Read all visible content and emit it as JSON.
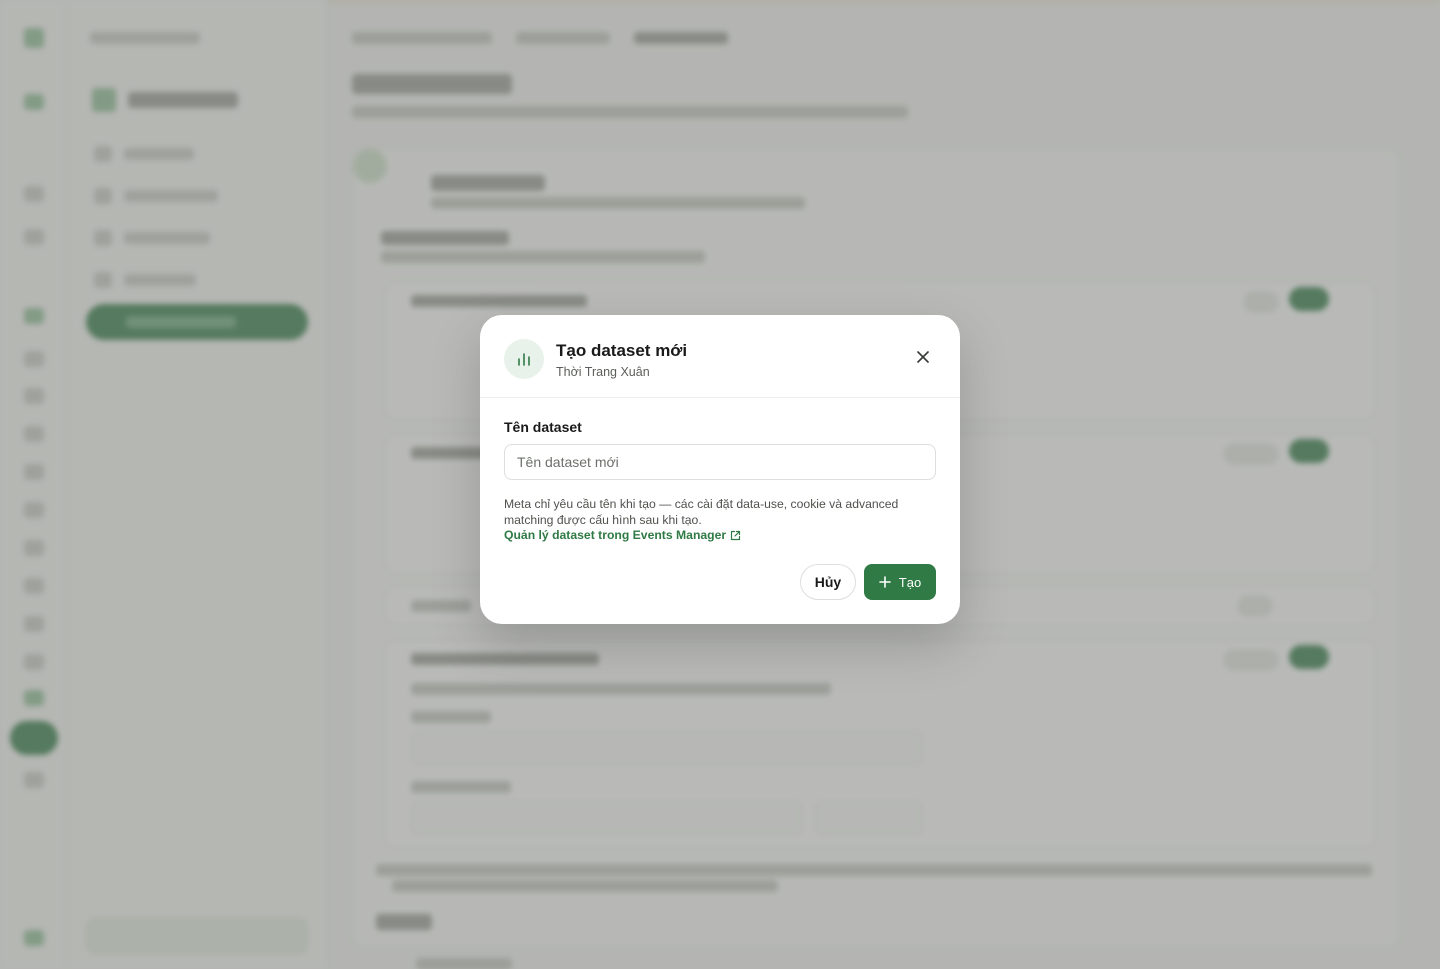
{
  "modal": {
    "title": "Tạo dataset mới",
    "subtitle": "Thời Trang Xuân",
    "icon": "bar-chart-icon",
    "close_icon": "close-icon",
    "field_label": "Tên dataset",
    "field_value": "",
    "field_placeholder": "Tên dataset mới",
    "hint": "Meta chỉ yêu cầu tên khi tạo — các cài đặt data-use, cookie và advanced matching được cấu hình sau khi tạo.",
    "link_label": "Quản lý dataset trong Events Manager",
    "link_icon": "external-link-icon",
    "cancel_label": "Hủy",
    "create_label": "Tạo",
    "create_icon": "plus-icon"
  },
  "colors": {
    "accent": "#2f7a45",
    "overlay": "rgba(120,122,118,0.52)"
  }
}
